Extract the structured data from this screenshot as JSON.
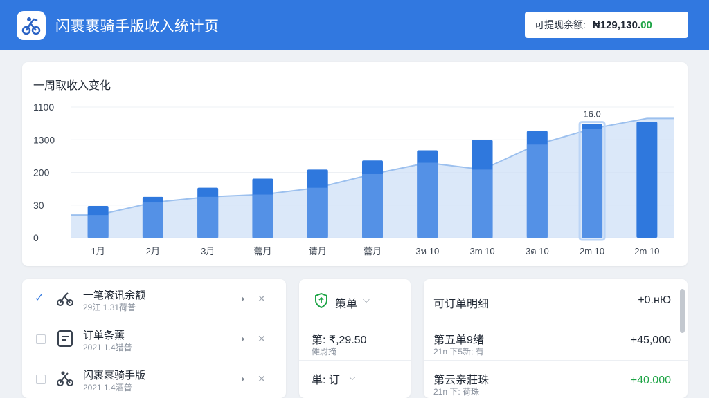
{
  "header": {
    "app_title": "闪裹裹骑手版收入统计页",
    "logo_icon": "scooter-rider-icon",
    "balance_label": "可提现余额:",
    "balance_value_main": "₦129,130.",
    "balance_value_cents": "00"
  },
  "colors": {
    "primary": "#3178e0",
    "bar": "#2f78dd",
    "bar_light": "#5a95e8",
    "area_fill": "#cfe0f7",
    "positive": "#1ea446"
  },
  "chart_data": {
    "type": "bar",
    "title": "一周取收入变化",
    "y_tick_labels": [
      "1100",
      "1300",
      "200",
      "30",
      "0"
    ],
    "categories": [
      "1月",
      "2月",
      "3月",
      "薷月",
      "请月",
      "薷月",
      "3ห 10",
      "3m 10",
      "3ต 10",
      "2m 10",
      "2m 10"
    ],
    "values": [
      0.28,
      0.36,
      0.44,
      0.52,
      0.6,
      0.68,
      0.77,
      0.86,
      0.94,
      1.0,
      1.02
    ],
    "trend_line": [
      0.2,
      0.31,
      0.36,
      0.38,
      0.44,
      0.56,
      0.66,
      0.6,
      0.82,
      0.96,
      1.05
    ],
    "ylim": [
      0,
      1.15
    ],
    "data_label": "16.0",
    "grid": true,
    "xlabel": "",
    "ylabel": ""
  },
  "list": {
    "items": [
      {
        "title": "一笔滚讯余额",
        "sub": "29江 1.31荷普",
        "checked": true,
        "icon": "scooter-icon"
      },
      {
        "title": "订单条薰",
        "sub": "2021 1.4猎普",
        "checked": false,
        "icon": "receipt-icon"
      },
      {
        "title": "闪裹裹骑手版",
        "sub": "2021 1.4酒普",
        "checked": false,
        "icon": "scooter-rider-icon"
      }
    ],
    "action1": "➝",
    "action2": "✕"
  },
  "orders": {
    "header_label": "策单",
    "header_chevron": "⌵",
    "rows": [
      {
        "main": "第: ₹,29.50",
        "sub": "傩尉掩"
      },
      {
        "main": "単: 订",
        "sub": "",
        "chevron": "⌵"
      }
    ]
  },
  "detail": {
    "title": "可订单明细",
    "total": "+0.нЮ",
    "rows": [
      {
        "name": "第五单9绪",
        "sub": "21n 下5新; 有",
        "amount": "+45,000",
        "green": false
      },
      {
        "name": "第云亲莊珠",
        "sub": "21n 下: 荷珠",
        "amount": "+40.000",
        "green": true
      }
    ]
  }
}
